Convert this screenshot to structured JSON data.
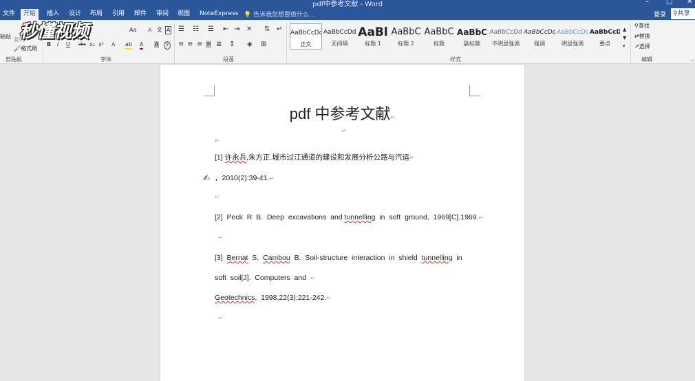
{
  "window": {
    "title": "pdf中参考文献 - Word",
    "min": "–",
    "max": "□",
    "close": "✕"
  },
  "menu": {
    "tabs": [
      "文件",
      "开始",
      "插入",
      "设计",
      "布局",
      "引用",
      "邮件",
      "审阅",
      "视图",
      "NoteExpress"
    ],
    "tell_me": "告诉我您想要做什么...",
    "login": "登录",
    "share": "共享"
  },
  "watermark": "秒懂视频",
  "ribbon": {
    "clipboard": {
      "label": "剪贴板",
      "paste": "粘贴",
      "format_painter": "格式刷",
      "copy": "复制"
    },
    "font": {
      "label": "字体",
      "grow": "A⁺",
      "shrink": "A⁻",
      "case": "Aa",
      "clear": "A",
      "phonetic": "文",
      "border": "A",
      "bold": "B",
      "italic": "I",
      "underline": "U",
      "strike": "abc",
      "sub": "x₂",
      "sup": "x²",
      "effects": "A",
      "highlight": "ab",
      "color": "A",
      "shade": "A",
      "circle": "字"
    },
    "paragraph": {
      "label": "段落"
    },
    "styles": {
      "label": "样式",
      "items": [
        {
          "sample": "AaBbCcDd",
          "name": "正文"
        },
        {
          "sample": "AaBbCcDd",
          "name": "无间隔"
        },
        {
          "sample": "AaBl",
          "name": "标题 1"
        },
        {
          "sample": "AaBbC",
          "name": "标题 2"
        },
        {
          "sample": "AaBbC",
          "name": "标题"
        },
        {
          "sample": "AaBbC",
          "name": "副标题"
        },
        {
          "sample": "AaBbCcDd",
          "name": "不明显强调"
        },
        {
          "sample": "AaBbCcDd",
          "name": "强调"
        },
        {
          "sample": "AaBbCcDd",
          "name": "明显强调"
        },
        {
          "sample": "AaBbCcD",
          "name": "要点"
        }
      ]
    },
    "editing": {
      "label": "编辑",
      "find": "查找",
      "replace": "替换",
      "select": "选择"
    }
  },
  "document": {
    "title": "pdf 中参考文献",
    "para_mark": "↵",
    "refs": [
      {
        "num": "[1]",
        "author_a": "许永兵",
        "rest": ",朱方正.城市过江通道的建设和发展分析公路与汽运"
      },
      {
        "cont": "，2010(2):39-41."
      },
      {
        "num": "[2]",
        "text_a": "Peck  R  B.  Deep  excavations  and ",
        "squig": "tunnelling",
        "text_b": "  in  soft  ground,  1969[C].1969."
      },
      {
        "num": "[3]",
        "s1": "Bernat",
        "t1": "  S,  ",
        "s2": "Cambou",
        "t2": "  B.  Soil-structure  interaction  in  shield  ",
        "s3": "tunnelling",
        "t3": "  in"
      },
      {
        "cont": "soft  soil[J].  Computers  and  "
      },
      {
        "s": "Geotechnics",
        "t": ",  1998,22(3):221-242."
      }
    ]
  },
  "colors": {
    "brand": "#2b579a",
    "ribbon": "#f3f3f3",
    "page": "#ffffff",
    "workspace": "#e6e6e6"
  }
}
